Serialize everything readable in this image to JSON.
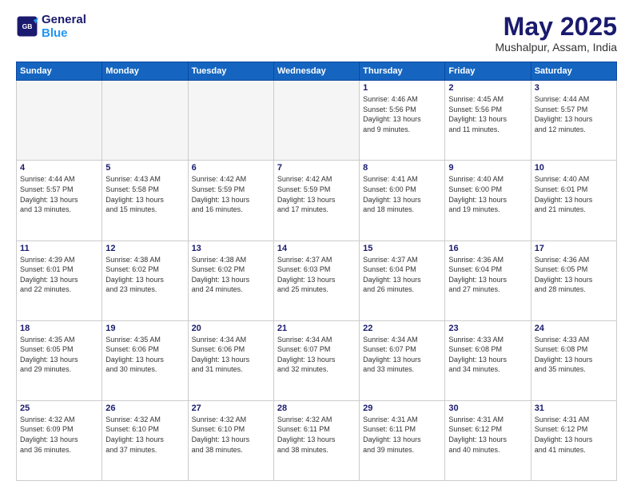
{
  "logo": {
    "line1": "General",
    "line2": "Blue"
  },
  "title": "May 2025",
  "location": "Mushalpur, Assam, India",
  "headers": [
    "Sunday",
    "Monday",
    "Tuesday",
    "Wednesday",
    "Thursday",
    "Friday",
    "Saturday"
  ],
  "weeks": [
    [
      {
        "day": "",
        "info": ""
      },
      {
        "day": "",
        "info": ""
      },
      {
        "day": "",
        "info": ""
      },
      {
        "day": "",
        "info": ""
      },
      {
        "day": "1",
        "info": "Sunrise: 4:46 AM\nSunset: 5:56 PM\nDaylight: 13 hours\nand 9 minutes."
      },
      {
        "day": "2",
        "info": "Sunrise: 4:45 AM\nSunset: 5:56 PM\nDaylight: 13 hours\nand 11 minutes."
      },
      {
        "day": "3",
        "info": "Sunrise: 4:44 AM\nSunset: 5:57 PM\nDaylight: 13 hours\nand 12 minutes."
      }
    ],
    [
      {
        "day": "4",
        "info": "Sunrise: 4:44 AM\nSunset: 5:57 PM\nDaylight: 13 hours\nand 13 minutes."
      },
      {
        "day": "5",
        "info": "Sunrise: 4:43 AM\nSunset: 5:58 PM\nDaylight: 13 hours\nand 15 minutes."
      },
      {
        "day": "6",
        "info": "Sunrise: 4:42 AM\nSunset: 5:59 PM\nDaylight: 13 hours\nand 16 minutes."
      },
      {
        "day": "7",
        "info": "Sunrise: 4:42 AM\nSunset: 5:59 PM\nDaylight: 13 hours\nand 17 minutes."
      },
      {
        "day": "8",
        "info": "Sunrise: 4:41 AM\nSunset: 6:00 PM\nDaylight: 13 hours\nand 18 minutes."
      },
      {
        "day": "9",
        "info": "Sunrise: 4:40 AM\nSunset: 6:00 PM\nDaylight: 13 hours\nand 19 minutes."
      },
      {
        "day": "10",
        "info": "Sunrise: 4:40 AM\nSunset: 6:01 PM\nDaylight: 13 hours\nand 21 minutes."
      }
    ],
    [
      {
        "day": "11",
        "info": "Sunrise: 4:39 AM\nSunset: 6:01 PM\nDaylight: 13 hours\nand 22 minutes."
      },
      {
        "day": "12",
        "info": "Sunrise: 4:38 AM\nSunset: 6:02 PM\nDaylight: 13 hours\nand 23 minutes."
      },
      {
        "day": "13",
        "info": "Sunrise: 4:38 AM\nSunset: 6:02 PM\nDaylight: 13 hours\nand 24 minutes."
      },
      {
        "day": "14",
        "info": "Sunrise: 4:37 AM\nSunset: 6:03 PM\nDaylight: 13 hours\nand 25 minutes."
      },
      {
        "day": "15",
        "info": "Sunrise: 4:37 AM\nSunset: 6:04 PM\nDaylight: 13 hours\nand 26 minutes."
      },
      {
        "day": "16",
        "info": "Sunrise: 4:36 AM\nSunset: 6:04 PM\nDaylight: 13 hours\nand 27 minutes."
      },
      {
        "day": "17",
        "info": "Sunrise: 4:36 AM\nSunset: 6:05 PM\nDaylight: 13 hours\nand 28 minutes."
      }
    ],
    [
      {
        "day": "18",
        "info": "Sunrise: 4:35 AM\nSunset: 6:05 PM\nDaylight: 13 hours\nand 29 minutes."
      },
      {
        "day": "19",
        "info": "Sunrise: 4:35 AM\nSunset: 6:06 PM\nDaylight: 13 hours\nand 30 minutes."
      },
      {
        "day": "20",
        "info": "Sunrise: 4:34 AM\nSunset: 6:06 PM\nDaylight: 13 hours\nand 31 minutes."
      },
      {
        "day": "21",
        "info": "Sunrise: 4:34 AM\nSunset: 6:07 PM\nDaylight: 13 hours\nand 32 minutes."
      },
      {
        "day": "22",
        "info": "Sunrise: 4:34 AM\nSunset: 6:07 PM\nDaylight: 13 hours\nand 33 minutes."
      },
      {
        "day": "23",
        "info": "Sunrise: 4:33 AM\nSunset: 6:08 PM\nDaylight: 13 hours\nand 34 minutes."
      },
      {
        "day": "24",
        "info": "Sunrise: 4:33 AM\nSunset: 6:08 PM\nDaylight: 13 hours\nand 35 minutes."
      }
    ],
    [
      {
        "day": "25",
        "info": "Sunrise: 4:32 AM\nSunset: 6:09 PM\nDaylight: 13 hours\nand 36 minutes."
      },
      {
        "day": "26",
        "info": "Sunrise: 4:32 AM\nSunset: 6:10 PM\nDaylight: 13 hours\nand 37 minutes."
      },
      {
        "day": "27",
        "info": "Sunrise: 4:32 AM\nSunset: 6:10 PM\nDaylight: 13 hours\nand 38 minutes."
      },
      {
        "day": "28",
        "info": "Sunrise: 4:32 AM\nSunset: 6:11 PM\nDaylight: 13 hours\nand 38 minutes."
      },
      {
        "day": "29",
        "info": "Sunrise: 4:31 AM\nSunset: 6:11 PM\nDaylight: 13 hours\nand 39 minutes."
      },
      {
        "day": "30",
        "info": "Sunrise: 4:31 AM\nSunset: 6:12 PM\nDaylight: 13 hours\nand 40 minutes."
      },
      {
        "day": "31",
        "info": "Sunrise: 4:31 AM\nSunset: 6:12 PM\nDaylight: 13 hours\nand 41 minutes."
      }
    ]
  ]
}
